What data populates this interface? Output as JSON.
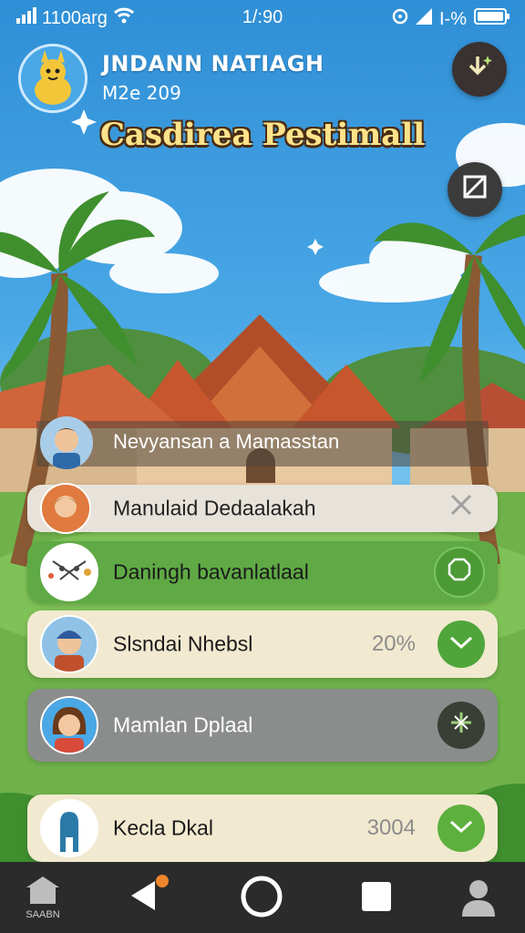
{
  "status_bar": {
    "carrier": "1100arg",
    "time": "1/:90",
    "battery": "I-%"
  },
  "profile": {
    "name": "JNDANN NATIAGH",
    "sub": "M2e 209"
  },
  "title": "Casdirea Pestimall",
  "subtitle": "Nevyansan a Mamasstan",
  "cards": [
    {
      "label": "Manulaid Dedaalakah",
      "pct": "",
      "action_icon": "close-icon"
    },
    {
      "label": "Daningh bavanlatlaal",
      "pct": "",
      "action_icon": "octagon-icon"
    },
    {
      "label": "Slsndai Nhebsl",
      "pct": "20%",
      "action_icon": "chevron-check-icon"
    },
    {
      "label": "Mamlan Dplaal",
      "pct": "",
      "action_icon": "sparkle-icon"
    },
    {
      "label": "Kecla Dkal",
      "pct": "3004",
      "action_icon": "chevron-check-icon"
    }
  ],
  "bottom_nav": {
    "left_label": "SAABN"
  },
  "colors": {
    "sky": "#2f8fd6",
    "green_card": "#5faa45",
    "cream_card": "#f1e9d0",
    "gray_card": "#8a8d8c",
    "accent_green": "#4fa53a",
    "dark_button": "#3a3230"
  }
}
